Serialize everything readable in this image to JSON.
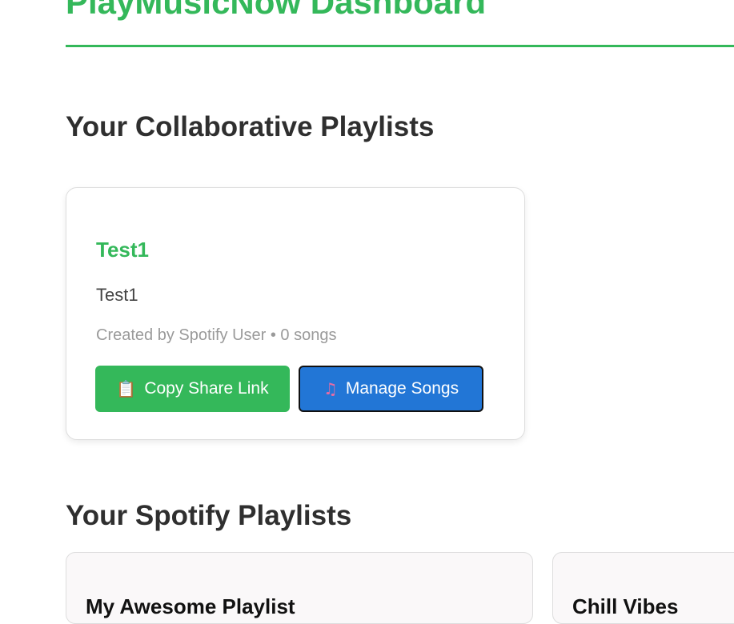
{
  "header": {
    "title": "PlayMusicNow Dashboard"
  },
  "sections": {
    "collaborative_title": "Your Collaborative Playlists",
    "spotify_title": "Your Spotify Playlists"
  },
  "collaborative_playlists": [
    {
      "name": "Test1",
      "description": "Test1",
      "meta": "Created by Spotify User • 0 songs",
      "copy_button_icon": "📋",
      "copy_button_label": "Copy Share Link",
      "manage_button_icon": "♫",
      "manage_button_label": "Manage Songs"
    }
  ],
  "spotify_playlists": [
    {
      "name": "My Awesome Playlist"
    },
    {
      "name": "Chill Vibes"
    }
  ],
  "colors": {
    "brand_green": "#34b85a",
    "primary_blue": "#2276d6",
    "text_dark": "#2f2f2f",
    "meta_gray": "#9a9a9a"
  }
}
